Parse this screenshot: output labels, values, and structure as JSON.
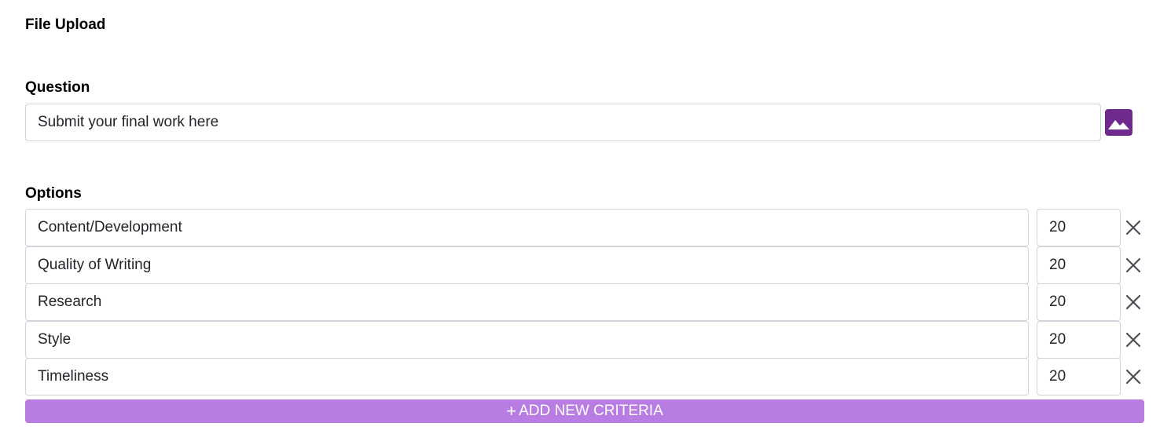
{
  "title": "File Upload",
  "question": {
    "label": "Question",
    "value": "Submit your final work here",
    "image_button_icon": "image-icon",
    "image_button_color": "#6f2a8f"
  },
  "options": {
    "label": "Options",
    "items": [
      {
        "label": "Content/Development",
        "points": "20"
      },
      {
        "label": "Quality of Writing",
        "points": "20"
      },
      {
        "label": "Research",
        "points": "20"
      },
      {
        "label": "Style",
        "points": "20"
      },
      {
        "label": "Timeliness",
        "points": "20"
      }
    ],
    "remove_icon": "close-icon"
  },
  "add_button": {
    "icon": "+",
    "label": "ADD NEW CRITERIA",
    "color": "#b97ce2"
  }
}
